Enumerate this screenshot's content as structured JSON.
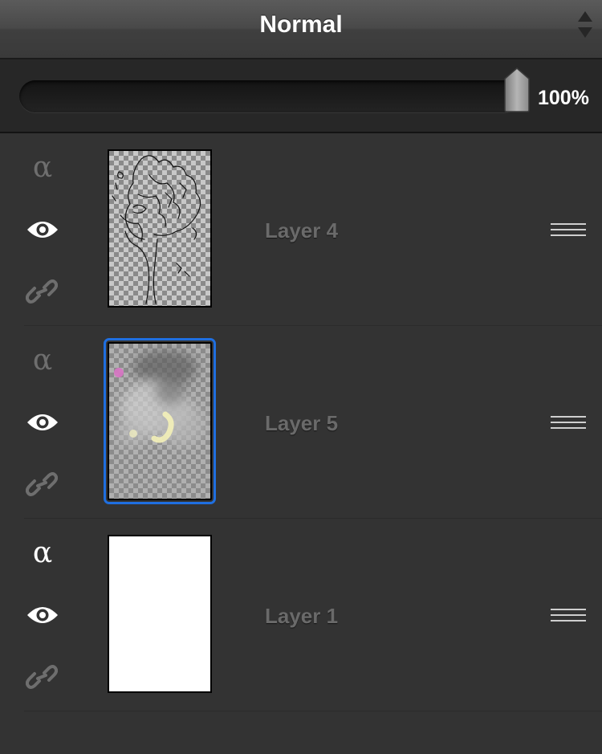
{
  "blend_header": {
    "mode_label": "Normal",
    "stepper_icon": "up-down-stepper-icon"
  },
  "opacity": {
    "value_text": "100%",
    "level_percent": 100
  },
  "layers": [
    {
      "name": "Layer 4",
      "alpha_symbol": "α",
      "alpha_lock_active": false,
      "visible": true,
      "linked": false,
      "thumbnail": "line-art-sketch-transparent",
      "selected": false
    },
    {
      "name": "Layer 5",
      "alpha_symbol": "α",
      "alpha_lock_active": false,
      "visible": true,
      "linked": false,
      "thumbnail": "soft-shading-transparent",
      "selected": true
    },
    {
      "name": "Layer 1",
      "alpha_symbol": "α",
      "alpha_lock_active": true,
      "visible": true,
      "linked": false,
      "thumbnail": "white-fill",
      "selected": false
    }
  ],
  "colors": {
    "panel_bg": "#333333",
    "selection_outline": "#1f6fe0",
    "inactive_icon": "#6e6e6e",
    "active_icon": "#ffffff"
  }
}
